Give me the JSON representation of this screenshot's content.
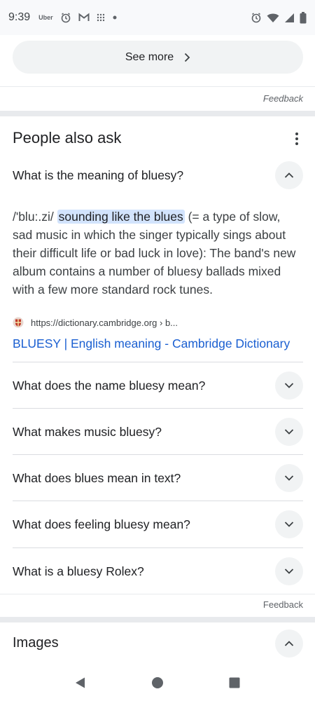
{
  "status_bar": {
    "time": "9:39",
    "uber_label": "Uber",
    "left_icons": [
      "uber-icon",
      "alarm-icon",
      "gmail-icon",
      "grid-icon",
      "dot-icon"
    ],
    "right_icons": [
      "alarm-icon",
      "wifi-icon",
      "signal-icon",
      "battery-icon"
    ]
  },
  "see_more": {
    "label": "See more"
  },
  "feedback_top": "Feedback",
  "people_also_ask": {
    "title": "People also ask",
    "expanded": {
      "question": "What is the meaning of bluesy?",
      "answer_prefix": "/'blu:.zi/ ",
      "answer_highlight": "sounding like the blues",
      "answer_rest": " (= a type of slow, sad music in which the singer typically sings about their difficult life or bad luck in love): The band's new album contains a number of bluesy ballads mixed with a few more standard rock tunes.",
      "source_url": "https://dictionary.cambridge.org › b...",
      "source_title": "BLUESY | English meaning - Cambridge Dictionary"
    },
    "questions": [
      "What does the name bluesy mean?",
      "What makes music bluesy?",
      "What does blues mean in text?",
      "What does feeling bluesy mean?",
      "What is a bluesy Rolex?"
    ]
  },
  "feedback_bottom": "Feedback",
  "images_section": {
    "title": "Images"
  },
  "nav": [
    "back-icon",
    "home-icon",
    "recents-icon"
  ],
  "colors": {
    "link": "#1a5fd1",
    "highlight": "#d2e3fc",
    "chip_bg": "#f1f3f4"
  }
}
